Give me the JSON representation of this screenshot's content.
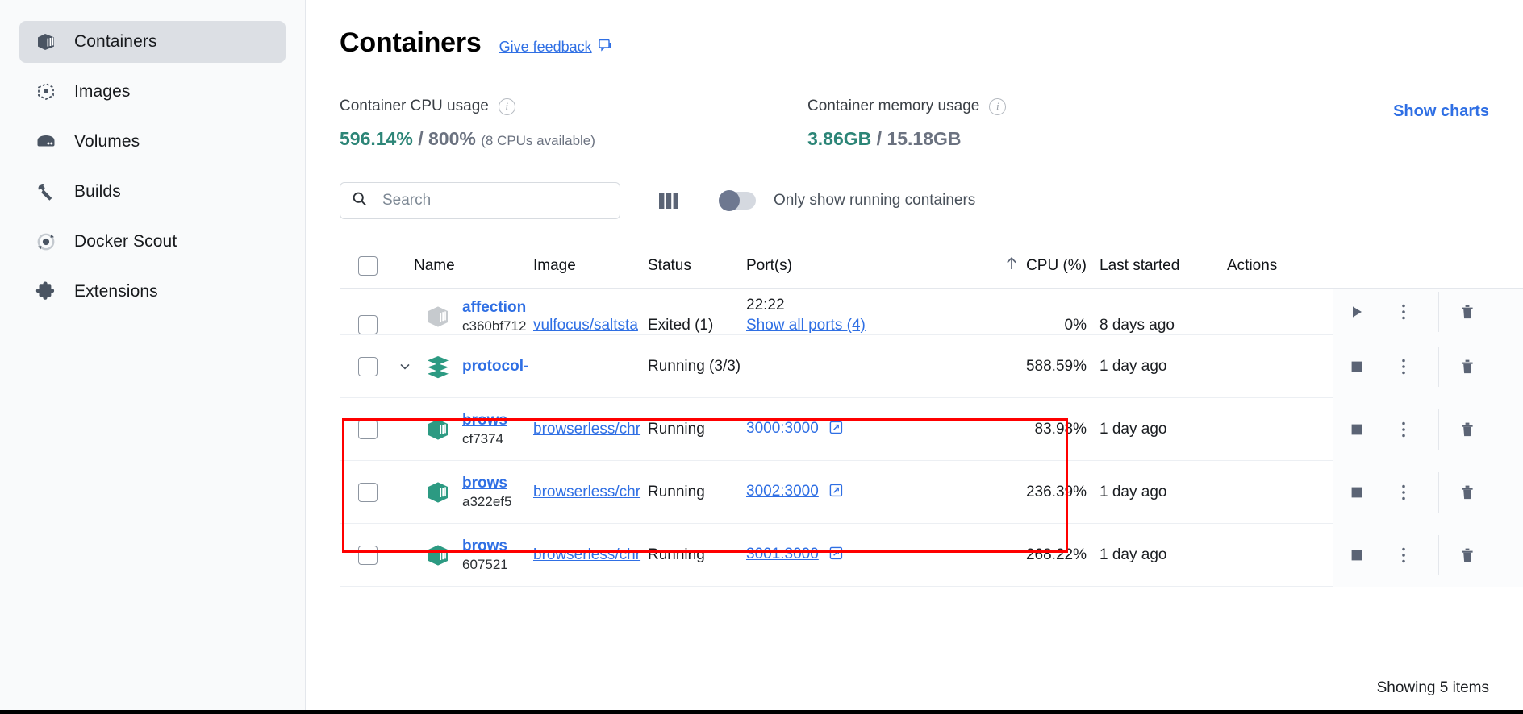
{
  "sidebar": {
    "items": [
      {
        "label": "Containers",
        "icon": "container-icon",
        "active": true
      },
      {
        "label": "Images",
        "icon": "images-icon",
        "active": false
      },
      {
        "label": "Volumes",
        "icon": "volumes-icon",
        "active": false
      },
      {
        "label": "Builds",
        "icon": "builds-wrench-icon",
        "active": false
      },
      {
        "label": "Docker Scout",
        "icon": "docker-scout-icon",
        "active": false
      },
      {
        "label": "Extensions",
        "icon": "extensions-puzzle-icon",
        "active": false
      }
    ]
  },
  "header": {
    "title": "Containers",
    "feedback_label": "Give feedback",
    "feedback_icon": "feedback-chat-icon"
  },
  "stats": {
    "cpu": {
      "label": "Container CPU usage",
      "info_icon": "info-icon",
      "used": "596.14%",
      "separator": " / ",
      "total": "800%",
      "note": "(8 CPUs available)"
    },
    "memory": {
      "label": "Container memory usage",
      "info_icon": "info-icon",
      "used": "3.86GB",
      "separator": " / ",
      "total": "15.18GB",
      "note": ""
    },
    "show_charts_label": "Show charts"
  },
  "toolbar": {
    "search_placeholder": "Search",
    "search_value": "",
    "search_icon": "search-icon",
    "columns_icon": "columns-icon",
    "toggle_label": "Only show running containers",
    "toggle_on": false
  },
  "table": {
    "columns": [
      "Name",
      "Image",
      "Status",
      "Port(s)",
      "CPU (%)",
      "Last started",
      "Actions"
    ],
    "sort_column": "CPU (%)",
    "sort_icon": "arrow-up-icon",
    "rows": [
      {
        "type": "single",
        "clipped": true,
        "name": "affection",
        "id": "c360bf712",
        "image": "vulfocus/saltsta",
        "status": "Exited (1)",
        "ports_plain": "22:22",
        "ports_link": "Show all ports (4)",
        "cpu": "0%",
        "last_started": "8 days ago",
        "icon": "container-gray-icon",
        "actions": [
          "play-icon",
          "kebab-menu-icon",
          "delete-trash-icon"
        ]
      },
      {
        "type": "group",
        "name": "protocol-",
        "id": "",
        "image": "",
        "status": "Running (3/3)",
        "ports_plain": "",
        "ports_link": "",
        "cpu": "588.59%",
        "last_started": "1 day ago",
        "icon": "stack-layers-icon",
        "chevron": "chevron-down-icon",
        "actions": [
          "stop-icon",
          "kebab-menu-icon",
          "delete-trash-icon"
        ]
      },
      {
        "type": "child",
        "name": "brows",
        "id": "cf7374",
        "image": "browserless/chr",
        "status": "Running",
        "ports_plain": "",
        "ports_link": "3000:3000",
        "port_ext_icon": "external-link-icon",
        "cpu": "83.98%",
        "last_started": "1 day ago",
        "icon": "container-green-icon",
        "actions": [
          "stop-icon",
          "kebab-menu-icon",
          "delete-trash-icon"
        ]
      },
      {
        "type": "child",
        "name": "brows",
        "id": "a322ef5",
        "image": "browserless/chr",
        "status": "Running",
        "ports_plain": "",
        "ports_link": "3002:3000",
        "port_ext_icon": "external-link-icon",
        "cpu": "236.39%",
        "last_started": "1 day ago",
        "icon": "container-green-icon",
        "actions": [
          "stop-icon",
          "kebab-menu-icon",
          "delete-trash-icon"
        ]
      },
      {
        "type": "child",
        "name": "brows",
        "id": "607521",
        "image": "browserless/chr",
        "status": "Running",
        "ports_plain": "",
        "ports_link": "3001:3000",
        "port_ext_icon": "external-link-icon",
        "cpu": "268.22%",
        "last_started": "1 day ago",
        "icon": "container-green-icon",
        "actions": [
          "stop-icon",
          "kebab-menu-icon",
          "delete-trash-icon"
        ]
      }
    ]
  },
  "footer": {
    "showing_label": "Showing 5 items"
  },
  "annotation": {
    "highlight_color": "#ff0000"
  },
  "colors": {
    "accent_link": "#2f6fe4",
    "stat_used": "#2c8577",
    "sidebar_active": "#dcdfe4",
    "container_green": "#2c9a82",
    "container_gray": "#c6cace"
  }
}
